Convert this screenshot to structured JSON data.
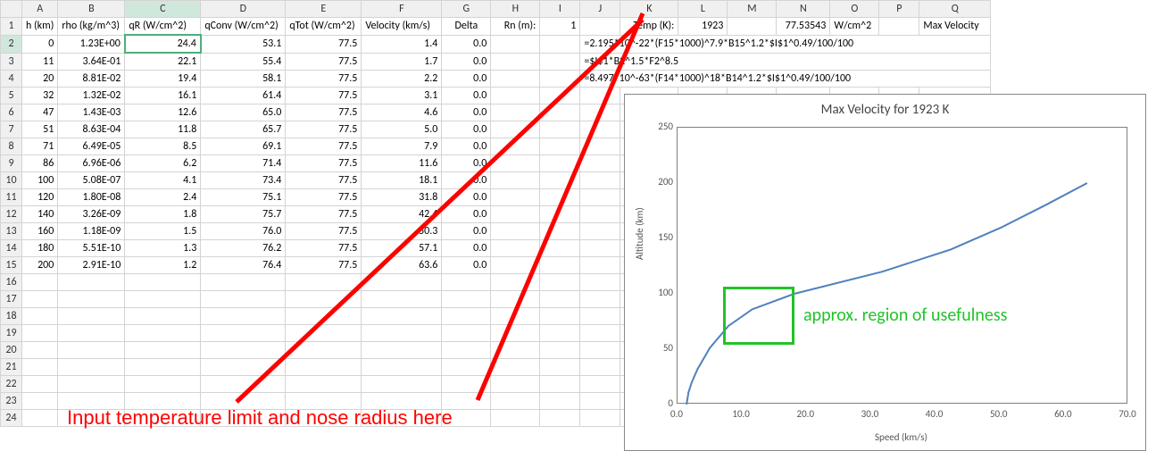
{
  "selected_cell": "C2",
  "columns": [
    "A",
    "B",
    "C",
    "D",
    "E",
    "F",
    "G",
    "H",
    "I",
    "J",
    "K",
    "L",
    "M",
    "N",
    "O",
    "P",
    "Q"
  ],
  "headers": {
    "A": "h (km)",
    "B": "rho (kg/m^3)",
    "C": "qR (W/cm^2)",
    "D": "qConv (W/cm^2)",
    "E": "qTot (W/cm^2)",
    "F": "Velocity (km/s)",
    "G": "Delta",
    "H": "Rn (m):",
    "I": "1",
    "K": "Temp (K):",
    "L": "1923",
    "N": "77.53543",
    "O": "W/cm^2",
    "Q": "Max Velocity"
  },
  "rows": [
    {
      "n": 2,
      "A": "0",
      "B": "1.23E+00",
      "C": "24.4",
      "D": "53.1",
      "E": "77.5",
      "F": "1.4",
      "G": "0.0",
      "J": "=2.195*10^-22*(F15*1000)^7.9*B15^1.2*$I$1^0.49/100/100"
    },
    {
      "n": 3,
      "A": "11",
      "B": "3.64E-01",
      "C": "22.1",
      "D": "55.4",
      "E": "77.5",
      "F": "1.7",
      "G": "0.0",
      "J": "=$I$1*B2^1.5*F2^8.5"
    },
    {
      "n": 4,
      "A": "20",
      "B": "8.81E-02",
      "C": "19.4",
      "D": "58.1",
      "E": "77.5",
      "F": "2.2",
      "G": "0.0",
      "J": "=8.497*10^-63*(F14*1000)^18*B14^1.2*$I$1^0.49/100/100"
    },
    {
      "n": 5,
      "A": "32",
      "B": "1.32E-02",
      "C": "16.1",
      "D": "61.4",
      "E": "77.5",
      "F": "3.1",
      "G": "0.0"
    },
    {
      "n": 6,
      "A": "47",
      "B": "1.43E-03",
      "C": "12.6",
      "D": "65.0",
      "E": "77.5",
      "F": "4.6",
      "G": "0.0"
    },
    {
      "n": 7,
      "A": "51",
      "B": "8.63E-04",
      "C": "11.8",
      "D": "65.7",
      "E": "77.5",
      "F": "5.0",
      "G": "0.0"
    },
    {
      "n": 8,
      "A": "71",
      "B": "6.49E-05",
      "C": "8.5",
      "D": "69.1",
      "E": "77.5",
      "F": "7.9",
      "G": "0.0"
    },
    {
      "n": 9,
      "A": "86",
      "B": "6.96E-06",
      "C": "6.2",
      "D": "71.4",
      "E": "77.5",
      "F": "11.6",
      "G": "0.0"
    },
    {
      "n": 10,
      "A": "100",
      "B": "5.08E-07",
      "C": "4.1",
      "D": "73.4",
      "E": "77.5",
      "F": "18.1",
      "G": "0.0"
    },
    {
      "n": 11,
      "A": "120",
      "B": "1.80E-08",
      "C": "2.4",
      "D": "75.1",
      "E": "77.5",
      "F": "31.8",
      "G": "0.0"
    },
    {
      "n": 12,
      "A": "140",
      "B": "3.26E-09",
      "C": "1.8",
      "D": "75.7",
      "E": "77.5",
      "F": "42.4",
      "G": "0.0"
    },
    {
      "n": 13,
      "A": "160",
      "B": "1.18E-09",
      "C": "1.5",
      "D": "76.0",
      "E": "77.5",
      "F": "50.3",
      "G": "0.0"
    },
    {
      "n": 14,
      "A": "180",
      "B": "5.51E-10",
      "C": "1.3",
      "D": "76.2",
      "E": "77.5",
      "F": "57.1",
      "G": "0.0"
    },
    {
      "n": 15,
      "A": "200",
      "B": "2.91E-10",
      "C": "1.2",
      "D": "76.4",
      "E": "77.5",
      "F": "63.6",
      "G": "0.0"
    }
  ],
  "empty_rows": [
    16,
    17,
    18,
    19,
    20,
    21,
    22,
    23,
    24
  ],
  "chart_data": {
    "type": "line",
    "title": "Max Velocity for 1923 K",
    "xlabel": "Speed (km/s)",
    "ylabel": "Altitude (km)",
    "xlim": [
      0,
      70
    ],
    "ylim": [
      0,
      250
    ],
    "xticks": [
      0.0,
      10.0,
      20.0,
      30.0,
      40.0,
      50.0,
      60.0,
      70.0
    ],
    "yticks": [
      0,
      50,
      100,
      150,
      200,
      250
    ],
    "series": [
      {
        "name": "Max Velocity",
        "x": [
          1.4,
          1.7,
          2.2,
          3.1,
          4.6,
          5.0,
          7.9,
          11.6,
          18.1,
          31.8,
          42.4,
          50.3,
          57.1,
          63.6
        ],
        "y": [
          0,
          11,
          20,
          32,
          47,
          51,
          71,
          86,
          100,
          120,
          140,
          160,
          180,
          200
        ]
      }
    ]
  },
  "annotations": {
    "red_text": "Input temperature limit and nose radius here",
    "green_text": "approx. region of usefulness"
  }
}
